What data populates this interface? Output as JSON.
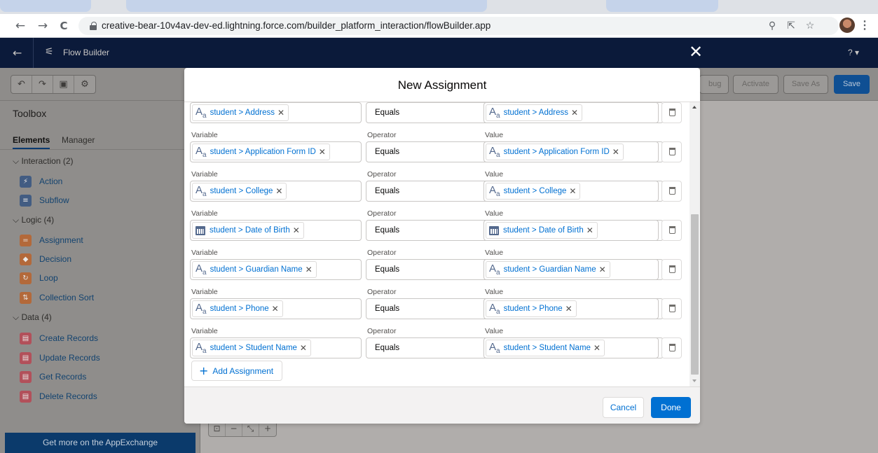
{
  "browser": {
    "url": "creative-bear-10v4av-dev-ed.lightning.force.com/builder_platform_interaction/flowBuilder.app",
    "back_icon": "←",
    "forward_icon": "→",
    "reload_icon": "C"
  },
  "app": {
    "title": "Flow Builder",
    "help": "? ▾",
    "close_icon": "✕"
  },
  "toolbar": {
    "debug_label": "bug",
    "activate_label": "Activate",
    "save_as_label": "Save As",
    "save_label": "Save"
  },
  "toolbox": {
    "title": "Toolbox",
    "tabs": [
      "Elements",
      "Manager"
    ],
    "sections": [
      {
        "label": "Interaction (2)",
        "items": [
          {
            "label": "Action",
            "color": "#425c82",
            "glyph": "⚡"
          },
          {
            "label": "Subflow",
            "color": "#425c82",
            "glyph": "≡"
          }
        ]
      },
      {
        "label": "Logic (4)",
        "items": [
          {
            "label": "Assignment",
            "color": "#b3693a",
            "glyph": "="
          },
          {
            "label": "Decision",
            "color": "#b3693a",
            "glyph": "◆"
          },
          {
            "label": "Loop",
            "color": "#b3693a",
            "glyph": "↻"
          },
          {
            "label": "Collection Sort",
            "color": "#b3693a",
            "glyph": "⇅"
          }
        ]
      },
      {
        "label": "Data (4)",
        "items": [
          {
            "label": "Create Records",
            "color": "#b2505a",
            "glyph": "▤"
          },
          {
            "label": "Update Records",
            "color": "#b2505a",
            "glyph": "▤"
          },
          {
            "label": "Get Records",
            "color": "#b2505a",
            "glyph": "▤"
          },
          {
            "label": "Delete Records",
            "color": "#b2505a",
            "glyph": "▤"
          }
        ]
      }
    ],
    "footer": "Get more on the AppExchange"
  },
  "modal": {
    "title": "New Assignment",
    "labels": {
      "variable": "Variable",
      "operator": "Operator",
      "value": "Value"
    },
    "rows": [
      {
        "variable": "student > Address",
        "operator": "Equals",
        "value": "student > Address",
        "icon": "text"
      },
      {
        "variable": "student > Application Form ID",
        "operator": "Equals",
        "value": "student > Application Form ID",
        "icon": "text"
      },
      {
        "variable": "student > College",
        "operator": "Equals",
        "value": "student > College",
        "icon": "text"
      },
      {
        "variable": "student > Date of Birth",
        "operator": "Equals",
        "value": "student > Date of Birth",
        "icon": "date"
      },
      {
        "variable": "student > Guardian Name",
        "operator": "Equals",
        "value": "student > Guardian Name",
        "icon": "text"
      },
      {
        "variable": "student > Phone",
        "operator": "Equals",
        "value": "student > Phone",
        "icon": "text"
      },
      {
        "variable": "student > Student Name",
        "operator": "Equals",
        "value": "student > Student Name",
        "icon": "text"
      }
    ],
    "add_assignment_label": "Add Assignment",
    "cancel_label": "Cancel",
    "done_label": "Done",
    "primary_color": "#0070d2"
  }
}
